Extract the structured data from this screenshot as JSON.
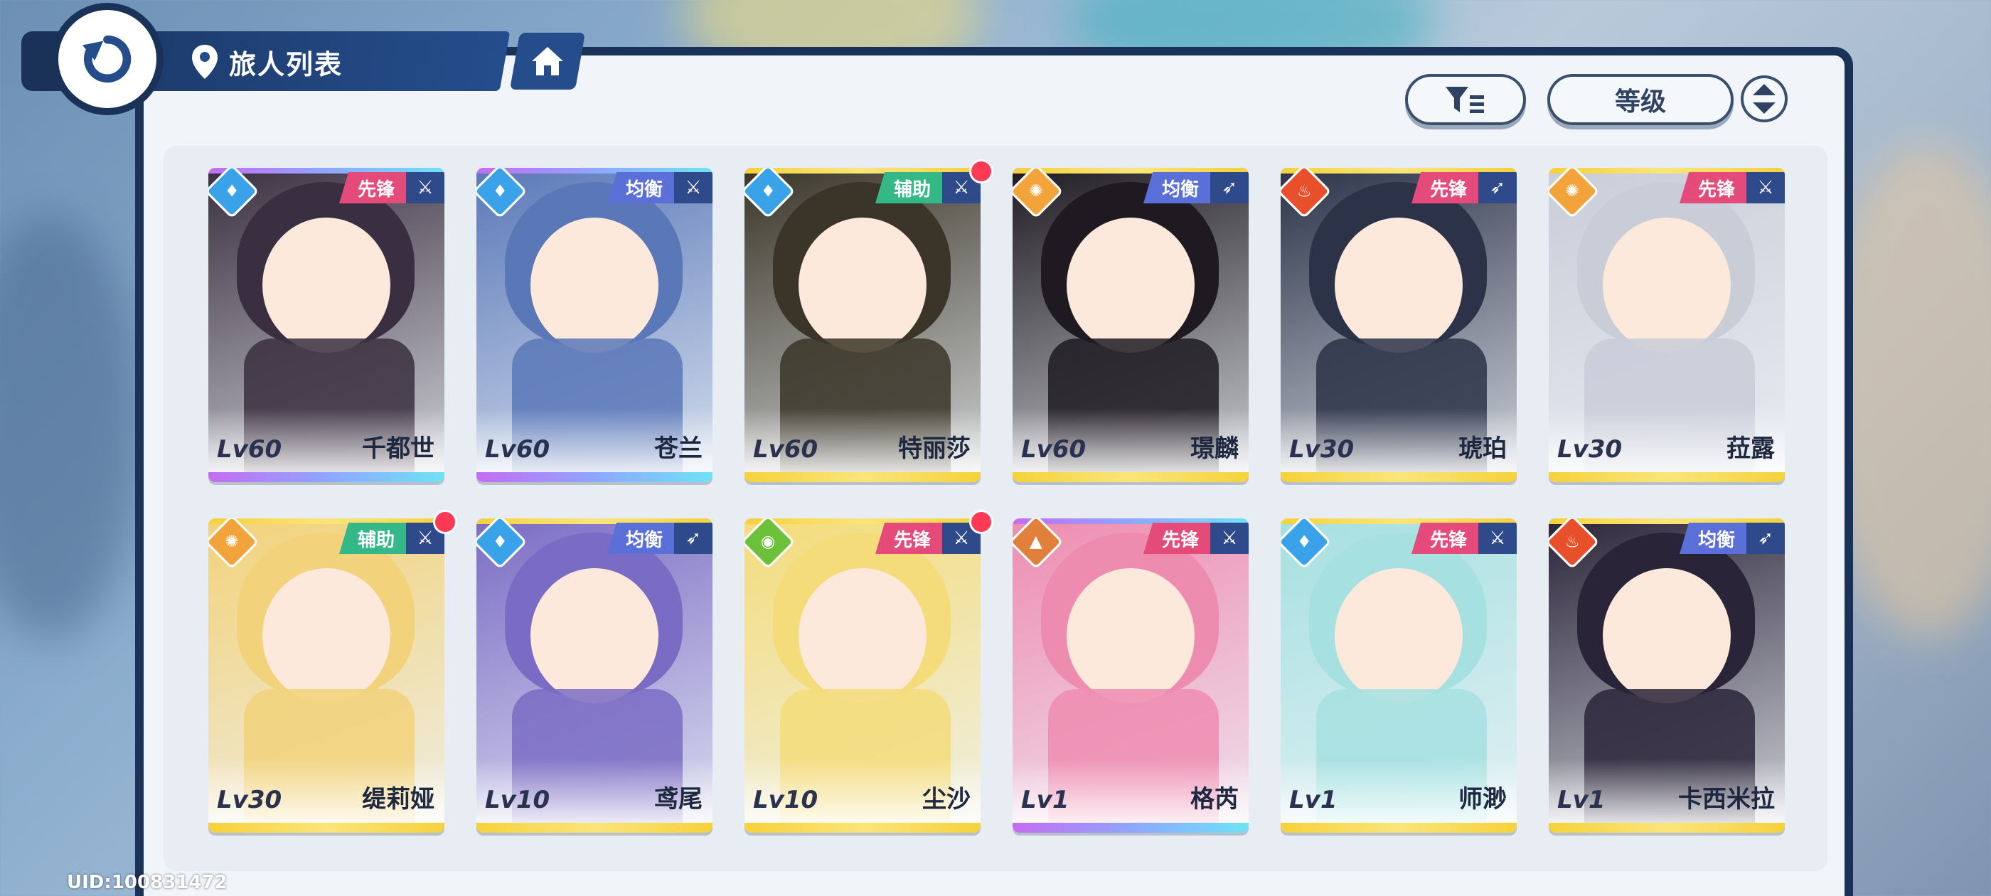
{
  "header": {
    "title": "旅人列表",
    "back_icon": "back-arrow-icon",
    "location_icon": "location-pin-icon",
    "home_icon": "home-icon"
  },
  "controls": {
    "filter_icon": "filter-icon",
    "sort_label": "等级",
    "order_icon": "sort-order-icon"
  },
  "characters": [
    {
      "level": "Lv60",
      "name": "千都世",
      "role": "先锋",
      "element": "water",
      "weapon": "sword",
      "role_color": "#e44a7a",
      "card_theme": "rainbow",
      "art": "#3a2f40",
      "new": false
    },
    {
      "level": "Lv60",
      "name": "苍兰",
      "role": "均衡",
      "element": "water",
      "weapon": "sword",
      "role_color": "#5a6fd8",
      "card_theme": "rainbow",
      "art": "#5a78b8",
      "new": false
    },
    {
      "level": "Lv60",
      "name": "特丽莎",
      "role": "辅助",
      "element": "water",
      "weapon": "sword",
      "role_color": "#35b888",
      "card_theme": "gold",
      "art": "#3a3528",
      "new": true
    },
    {
      "level": "Lv60",
      "name": "璟麟",
      "role": "均衡",
      "element": "sun",
      "weapon": "bow",
      "role_color": "#5a6fd8",
      "card_theme": "gold",
      "art": "#1f1a22",
      "new": false
    },
    {
      "level": "Lv30",
      "name": "琥珀",
      "role": "先锋",
      "element": "fire",
      "weapon": "bow",
      "role_color": "#e44a7a",
      "card_theme": "gold",
      "art": "#2c3348",
      "new": false
    },
    {
      "level": "Lv30",
      "name": "菈露",
      "role": "先锋",
      "element": "sun",
      "weapon": "sword",
      "role_color": "#e44a7a",
      "card_theme": "gold",
      "art": "#c9cdd8",
      "new": false
    },
    {
      "level": "Lv30",
      "name": "缇莉娅",
      "role": "辅助",
      "element": "sun",
      "weapon": "sword",
      "role_color": "#35b888",
      "card_theme": "gold",
      "art": "#f2d27a",
      "new": true
    },
    {
      "level": "Lv10",
      "name": "鸢尾",
      "role": "均衡",
      "element": "water",
      "weapon": "bow",
      "role_color": "#5a6fd8",
      "card_theme": "gold",
      "art": "#7a6cc4",
      "new": false
    },
    {
      "level": "Lv10",
      "name": "尘沙",
      "role": "先锋",
      "element": "wind",
      "weapon": "sword",
      "role_color": "#e44a7a",
      "card_theme": "gold",
      "art": "#f4dc7a",
      "new": true
    },
    {
      "level": "Lv1",
      "name": "格芮",
      "role": "先锋",
      "element": "earth",
      "weapon": "sword",
      "role_color": "#e44a7a",
      "card_theme": "rainbow",
      "art": "#ee8cb0",
      "new": false
    },
    {
      "level": "Lv1",
      "name": "师渺",
      "role": "先锋",
      "element": "water",
      "weapon": "sword",
      "role_color": "#e44a7a",
      "card_theme": "gold",
      "art": "#a6e0e0",
      "new": false
    },
    {
      "level": "Lv1",
      "name": "卡西米拉",
      "role": "均衡",
      "element": "fire",
      "weapon": "bow",
      "role_color": "#5a6fd8",
      "card_theme": "gold",
      "art": "#2a2438",
      "new": false
    }
  ],
  "footer": {
    "uid": "UID:100831472"
  },
  "colors": {
    "navy": "#1a3257",
    "panel": "#f1f5f9",
    "water": "#3aa2e8",
    "sun": "#f2a43a",
    "fire": "#e8502c",
    "wind": "#6cc03a",
    "earth": "#e0803a"
  }
}
